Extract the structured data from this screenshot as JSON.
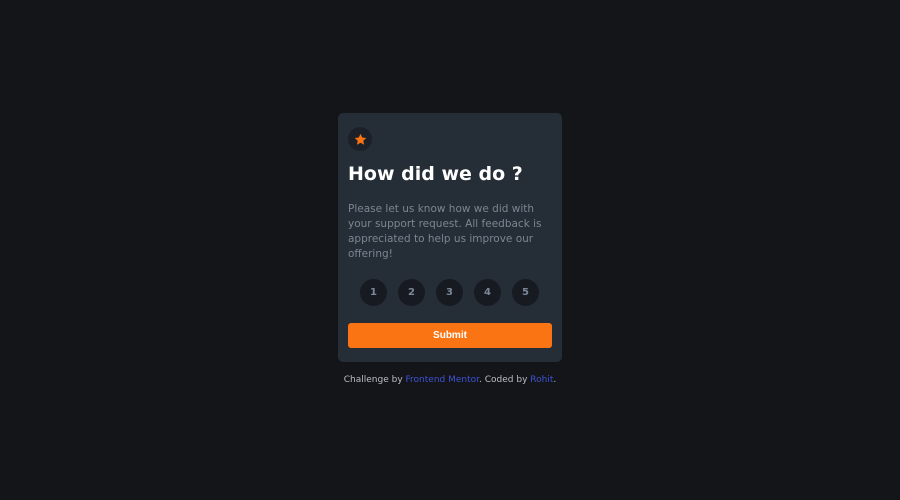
{
  "card": {
    "icon": "star-icon",
    "title": "How did we do ?",
    "description": "Please let us know how we did with your support request. All feedback is appreciated to help us improve our offering!",
    "ratings": [
      "1",
      "2",
      "3",
      "4",
      "5"
    ],
    "submit_label": "Submit"
  },
  "attribution": {
    "prefix": "Challenge by ",
    "challenge_link": "Frontend Mentor",
    "middle": ". Coded by ",
    "author_link": "Rohit",
    "suffix": "."
  },
  "colors": {
    "background": "#131518",
    "card": "#252d37",
    "accent": "#fb7413",
    "link": "#3e52d5"
  }
}
